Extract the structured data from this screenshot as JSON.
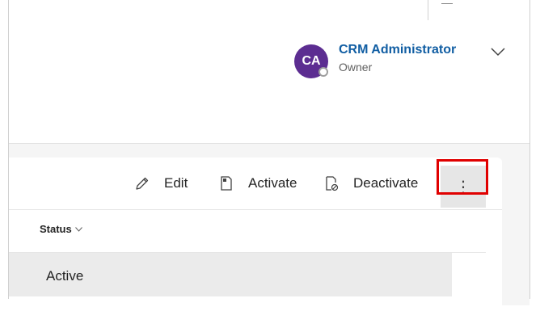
{
  "owner": {
    "initials": "CA",
    "name": "CRM Administrator",
    "role": "Owner",
    "avatar_color": "#5c2d91"
  },
  "commands": {
    "edit": "Edit",
    "activate": "Activate",
    "deactivate": "Deactivate",
    "more": "⋮"
  },
  "grid": {
    "columns": [
      "Status"
    ],
    "rows": [
      {
        "status": "Active"
      }
    ]
  },
  "icons": [
    "pencil-icon",
    "activate-icon",
    "deactivate-icon",
    "more-vertical-icon",
    "chevron-down-icon",
    "presence-icon"
  ],
  "colors": {
    "accent": "#115ea3",
    "highlight": "#e00000"
  }
}
